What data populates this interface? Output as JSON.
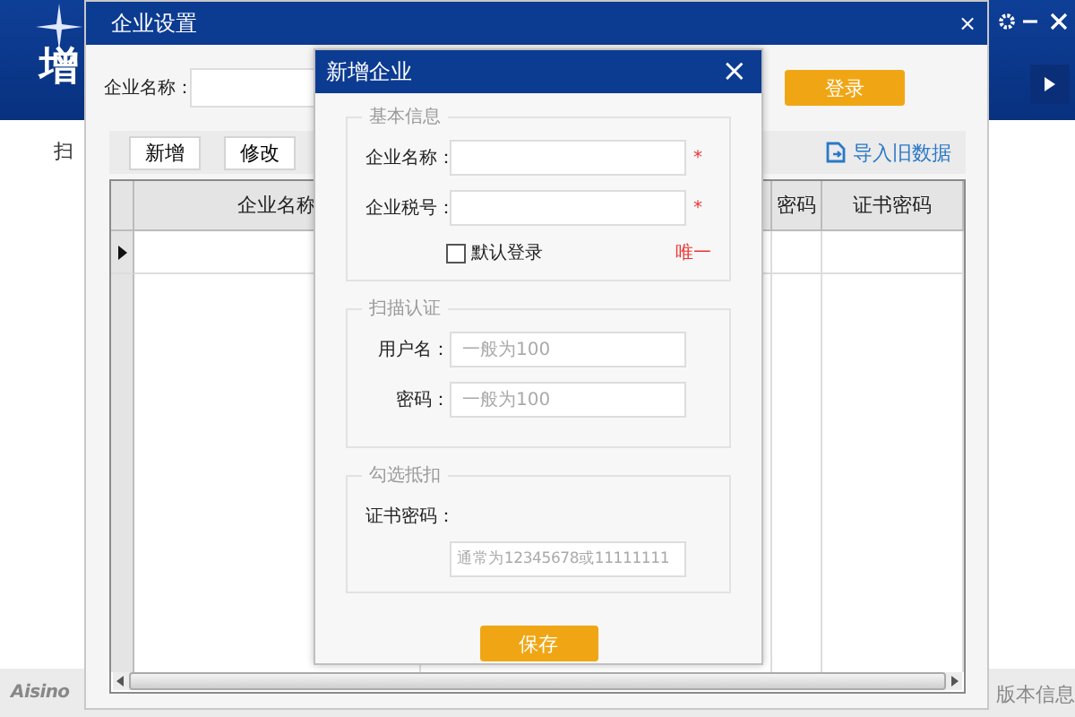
{
  "app": {
    "title": "增",
    "side_label": "扫",
    "logo": "Aisino",
    "version_link": "版本信息"
  },
  "settings_window": {
    "title": "企业设置",
    "close": "×",
    "name_label": "企业名称：",
    "login_button": "登录",
    "toolbar": [
      {
        "label": "新增"
      },
      {
        "label": "修改"
      }
    ],
    "import_button": "导入旧数据",
    "table": {
      "columns": [
        "企业名称",
        "",
        "密码",
        "证书密码"
      ],
      "rows": [
        {
          "current": true
        }
      ]
    }
  },
  "add_window": {
    "title": "新增企业",
    "close": "×",
    "sections": [
      {
        "legend": "基本信息",
        "fields": [
          {
            "kind": "inline",
            "label": "企业名称：",
            "required_mark": "*"
          },
          {
            "kind": "inline",
            "label": "企业税号：",
            "required_mark": "*"
          }
        ],
        "checkbox": {
          "label": "默认登录",
          "checked": false
        },
        "note": "唯一"
      },
      {
        "legend": "扫描认证",
        "fields": [
          {
            "kind": "inline",
            "label": "用户名：",
            "placeholder": "一般为100"
          },
          {
            "kind": "inline",
            "label": "密码：",
            "placeholder": "一般为100"
          }
        ]
      },
      {
        "legend": "勾选抵扣",
        "fields": [
          {
            "kind": "stacked",
            "label": "证书密码：",
            "placeholder": "通常为12345678或11111111"
          }
        ]
      }
    ],
    "save_button": "保存"
  }
}
